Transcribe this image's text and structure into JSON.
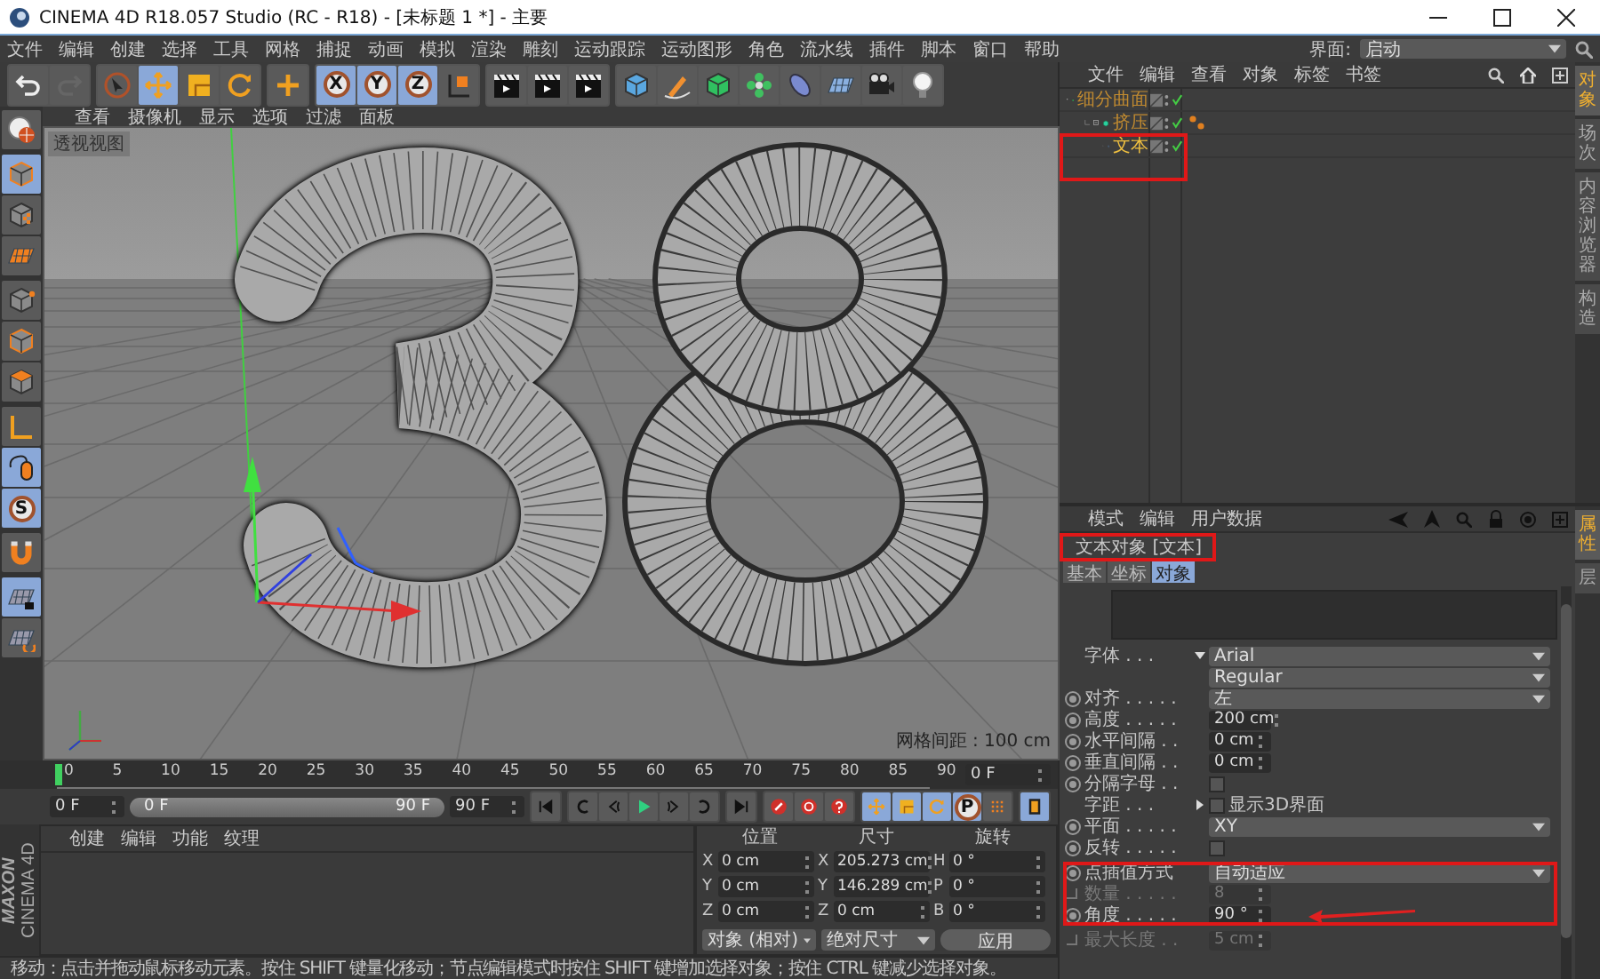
{
  "window": {
    "title": "CINEMA 4D R18.057 Studio (RC - R18) - [未标题 1 *] - 主要"
  },
  "menu": [
    "文件",
    "编辑",
    "创建",
    "选择",
    "工具",
    "网格",
    "捕捉",
    "动画",
    "模拟",
    "渲染",
    "雕刻",
    "运动跟踪",
    "运动图形",
    "角色",
    "流水线",
    "插件",
    "脚本",
    "窗口",
    "帮助"
  ],
  "layout": {
    "label": "界面:",
    "value": "启动"
  },
  "toolbar": [
    [
      {
        "kind": "undo",
        "selected": false
      },
      {
        "kind": "redo",
        "selected": false
      }
    ],
    [
      {
        "kind": "pointer",
        "selected": false
      },
      {
        "kind": "move",
        "selected": true
      },
      {
        "kind": "scale",
        "selected": false
      },
      {
        "kind": "rotate",
        "selected": false
      }
    ],
    [
      {
        "kind": "cross",
        "selected": false
      }
    ],
    [
      {
        "kind": "axis-lock",
        "label": "X",
        "selected": true
      },
      {
        "kind": "axis-lock",
        "label": "Y",
        "selected": true
      },
      {
        "kind": "axis-lock",
        "label": "Z",
        "selected": true
      },
      {
        "kind": "coord",
        "selected": false
      }
    ],
    [
      {
        "kind": "clapper",
        "selected": false
      },
      {
        "kind": "clapper",
        "selected": false
      },
      {
        "kind": "clapper",
        "selected": false
      }
    ],
    [
      {
        "kind": "cube",
        "selected": false
      },
      {
        "kind": "pen",
        "selected": false
      },
      {
        "kind": "subdiv",
        "selected": false
      },
      {
        "kind": "cloner",
        "selected": false
      },
      {
        "kind": "deformer",
        "selected": false
      },
      {
        "kind": "floor",
        "selected": false
      },
      {
        "kind": "camera",
        "selected": false
      },
      {
        "kind": "light",
        "selected": false
      }
    ]
  ],
  "left_tools": [
    [
      {
        "kind": "sphere",
        "selected": false
      }
    ],
    [
      {
        "kind": "model",
        "selected": true
      },
      {
        "kind": "texture",
        "selected": false
      },
      {
        "kind": "workplane",
        "selected": false
      }
    ],
    [
      {
        "kind": "points",
        "selected": false
      },
      {
        "kind": "edges",
        "selected": false
      },
      {
        "kind": "polygons",
        "selected": false
      }
    ],
    [
      {
        "kind": "axis",
        "selected": false
      },
      {
        "kind": "tweak",
        "selected": true
      },
      {
        "kind": "snap",
        "label": "S",
        "selected": true
      }
    ],
    [
      {
        "kind": "magnet",
        "selected": false
      }
    ],
    [
      {
        "kind": "gridlock",
        "selected": true
      },
      {
        "kind": "gridrotate",
        "selected": false
      }
    ]
  ],
  "viewport": {
    "menu": [
      "查看",
      "摄像机",
      "显示",
      "选项",
      "过滤",
      "面板"
    ],
    "view_name": "透视视图",
    "grid_info": "网格间距 : 100 cm"
  },
  "object_manager": {
    "menu": [
      "文件",
      "编辑",
      "查看",
      "对象",
      "标签",
      "书签"
    ],
    "objects": [
      {
        "name": "细分曲面",
        "kind": "subdiv",
        "selected": false,
        "has_tag": false,
        "highlighted": false,
        "children": [
          {
            "name": "挤压",
            "kind": "extrude",
            "selected": false,
            "has_tag": true,
            "highlighted": false,
            "children": [
              {
                "name": "文本",
                "kind": "text",
                "selected": true,
                "has_tag": false,
                "highlighted": true
              }
            ]
          }
        ]
      }
    ],
    "side_tabs": [
      {
        "label": "对象",
        "selected": true
      },
      {
        "label": "场次",
        "selected": false
      },
      {
        "label": "内容浏览器",
        "selected": false
      },
      {
        "label": "构造",
        "selected": false
      }
    ]
  },
  "attributes": {
    "menu": [
      "模式",
      "编辑",
      "用户数据"
    ],
    "header": "文本对象 [文本]",
    "header_highlighted": true,
    "tabs": [
      {
        "label": "基本",
        "selected": false
      },
      {
        "label": "坐标",
        "selected": false
      },
      {
        "label": "对象",
        "selected": true
      }
    ],
    "rows": [
      {
        "kind": "dropdown",
        "animatable": false,
        "toggle": {
          "expanded": true
        },
        "label": "字体 . . .",
        "value": "Arial",
        "disabled": false,
        "highlighted": false,
        "pointer_arrow": false
      },
      {
        "kind": "dropdown",
        "animatable": false,
        "value": "Regular",
        "disabled": false,
        "highlighted": false,
        "pointer_arrow": false
      },
      {
        "kind": "dropdown",
        "animatable": true,
        "label": "对齐 . . . . .",
        "value": "左",
        "disabled": false,
        "highlighted": false,
        "pointer_arrow": false
      },
      {
        "kind": "number",
        "animatable": true,
        "label": "高度 . . . . .",
        "value": "200 cm",
        "disabled": false,
        "highlighted": false,
        "pointer_arrow": false
      },
      {
        "kind": "number",
        "animatable": true,
        "label": "水平间隔 . .",
        "value": "0 cm",
        "disabled": false,
        "highlighted": false,
        "pointer_arrow": false
      },
      {
        "kind": "number",
        "animatable": true,
        "label": "垂直间隔 . .",
        "value": "0 cm",
        "disabled": false,
        "highlighted": false,
        "pointer_arrow": false
      },
      {
        "kind": "checkbox",
        "animatable": true,
        "label": "分隔字母 . .",
        "checked": false,
        "disabled": false,
        "highlighted": false,
        "pointer_arrow": false
      },
      {
        "kind": "checkbox",
        "animatable": false,
        "toggle": {
          "expanded": false
        },
        "label": "字距 . . .",
        "checked": false,
        "caption": "显示3D界面",
        "disabled": false,
        "highlighted": false,
        "pointer_arrow": false
      },
      {
        "kind": "dropdown",
        "animatable": true,
        "label": "平面 . . . . .",
        "value": "XY",
        "disabled": false,
        "highlighted": false,
        "pointer_arrow": false
      },
      {
        "kind": "checkbox",
        "animatable": true,
        "label": "反转 . . . . .",
        "checked": false,
        "disabled": false,
        "highlighted": false,
        "pointer_arrow": false
      },
      {
        "kind": "dropdown",
        "animatable": true,
        "label": "点插值方式",
        "value": "自动适应",
        "disabled": false,
        "highlighted": true,
        "pointer_arrow": false
      },
      {
        "kind": "number",
        "animatable": false,
        "label": "数量 . . . . .",
        "value": "8",
        "disabled": true,
        "highlighted": true,
        "pointer_arrow": false
      },
      {
        "kind": "number",
        "animatable": true,
        "label": "角度 . . . . .",
        "value": "90 °",
        "disabled": false,
        "highlighted": true,
        "pointer_arrow": true
      },
      {
        "kind": "number",
        "animatable": false,
        "label": "最大长度 . .",
        "value": "5 cm",
        "disabled": true,
        "highlighted": false,
        "pointer_arrow": false
      }
    ],
    "side_tabs": [
      {
        "label": "属性",
        "selected": true
      },
      {
        "label": "层",
        "selected": false
      }
    ]
  },
  "timeline": {
    "ticks": [
      "0",
      "5",
      "10",
      "15",
      "20",
      "25",
      "30",
      "35",
      "40",
      "45",
      "50",
      "55",
      "60",
      "65",
      "70",
      "75",
      "80",
      "85",
      "90"
    ],
    "playhead": {
      "level": 0
    },
    "frame_field": "0 F"
  },
  "playback": {
    "start": "0 F",
    "range": {
      "start": "0 F",
      "end": "90 F",
      "level": 1
    },
    "end": "90 F",
    "buttons": [
      [
        {
          "kind": "first",
          "selected": false
        }
      ],
      [
        {
          "kind": "loopback",
          "selected": false
        },
        {
          "kind": "prevkey",
          "selected": false
        },
        {
          "kind": "play",
          "selected": false
        },
        {
          "kind": "nextkey",
          "selected": false
        },
        {
          "kind": "loop",
          "selected": false
        }
      ],
      [
        {
          "kind": "last",
          "selected": false
        }
      ],
      [
        {
          "kind": "record",
          "selected": false
        },
        {
          "kind": "autokey",
          "selected": false
        },
        {
          "kind": "help",
          "selected": false
        }
      ],
      [
        {
          "kind": "move",
          "selected": true
        },
        {
          "kind": "scale",
          "selected": true
        },
        {
          "kind": "rotate",
          "selected": true
        },
        {
          "kind": "param",
          "label": "P",
          "selected": true
        },
        {
          "kind": "dots",
          "selected": false
        }
      ],
      [
        {
          "kind": "film",
          "selected": true
        }
      ]
    ]
  },
  "materials": {
    "menu": [
      "创建",
      "编辑",
      "功能",
      "纹理"
    ]
  },
  "coordinates": {
    "headers": [
      "位置",
      "尺寸",
      "旋转"
    ],
    "rows": [
      [
        {
          "axis": "X",
          "value": "0 cm"
        },
        {
          "axis": "X",
          "value": "205.273 cm"
        },
        {
          "axis": "H",
          "value": "0 °"
        }
      ],
      [
        {
          "axis": "Y",
          "value": "0 cm"
        },
        {
          "axis": "Y",
          "value": "146.289 cm"
        },
        {
          "axis": "P",
          "value": "0 °"
        }
      ],
      [
        {
          "axis": "Z",
          "value": "0 cm"
        },
        {
          "axis": "Z",
          "value": "0 cm"
        },
        {
          "axis": "B",
          "value": "0 °"
        }
      ]
    ],
    "mode": "对象 (相对)",
    "size_mode": "绝对尺寸",
    "apply": "应用"
  },
  "logo": {
    "brand": "MAXON",
    "product": "CINEMA 4D"
  },
  "status": "移动：点击并拖动鼠标移动元素。按住 SHIFT 键量化移动；节点编辑模式时按住 SHIFT 键增加选择对象；按住 CTRL 键减少选择对象。"
}
